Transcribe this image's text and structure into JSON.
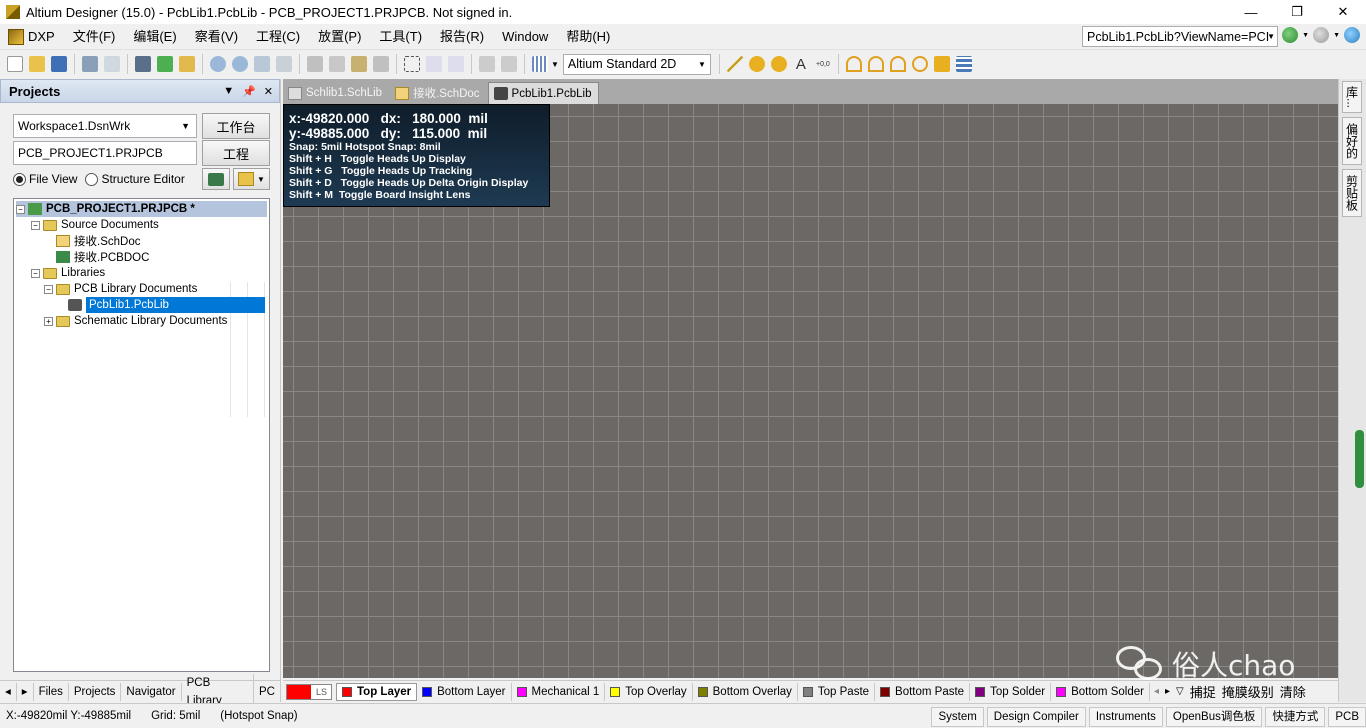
{
  "window": {
    "title": "Altium Designer (15.0) - PcbLib1.PcbLib - PCB_PROJECT1.PRJPCB. Not signed in.",
    "controls": [
      "—",
      "❐",
      "✕"
    ]
  },
  "menu": {
    "items": [
      "DXP",
      "文件(F)",
      "编辑(E)",
      "察看(V)",
      "工程(C)",
      "放置(P)",
      "工具(T)",
      "报告(R)",
      "Window",
      "帮助(H)"
    ],
    "address": "PcbLib1.PcbLib?ViewName=PCI"
  },
  "toolbar": {
    "view_mode": "Altium Standard 2D"
  },
  "projects_panel": {
    "title": "Projects",
    "workspace": "Workspace1.DsnWrk",
    "workspace_button": "工作台",
    "project": "PCB_PROJECT1.PRJPCB",
    "project_button": "工程",
    "view_options": [
      "File View",
      "Structure Editor"
    ],
    "tree": {
      "root": "PCB_PROJECT1.PRJPCB *",
      "source_documents": "Source Documents",
      "sch_doc": "接收.SchDoc",
      "pcb_doc": "接收.PCBDOC",
      "libraries": "Libraries",
      "pcb_library_documents": "PCB Library Documents",
      "pcb_lib": "PcbLib1.PcbLib",
      "schematic_library_documents": "Schematic Library Documents"
    },
    "bottom_tabs": [
      "Files",
      "Projects",
      "Navigator",
      "PCB Library",
      "PC"
    ]
  },
  "document_tabs": [
    "Schlib1.SchLib",
    "接收.SchDoc",
    "PcbLib1.PcbLib"
  ],
  "hud": {
    "line1": "x:-49820.000   dx:   180.000  mil",
    "line2": "y:-49885.000   dy:   115.000  mil",
    "snap": "Snap: 5mil Hotspot Snap: 8mil",
    "shortcuts": [
      "Shift + H   Toggle Heads Up Display",
      "Shift + G   Toggle Heads Up Tracking",
      "Shift + D   Toggle Heads Up Delta Origin Display",
      "Shift + M  Toggle Board Insight Lens"
    ]
  },
  "layers": {
    "ls_label": "LS",
    "items": [
      {
        "name": "Top Layer",
        "color": "#ff0000"
      },
      {
        "name": "Bottom Layer",
        "color": "#0000ff"
      },
      {
        "name": "Mechanical 1",
        "color": "#ff00ff"
      },
      {
        "name": "Top Overlay",
        "color": "#ffff00"
      },
      {
        "name": "Bottom Overlay",
        "color": "#808000"
      },
      {
        "name": "Top Paste",
        "color": "#808080"
      },
      {
        "name": "Bottom Paste",
        "color": "#800000"
      },
      {
        "name": "Top Solder",
        "color": "#800080"
      },
      {
        "name": "Bottom Solder",
        "color": "#ff00ff"
      }
    ],
    "tail_buttons": [
      "捕捉",
      "掩膜级别",
      "清除"
    ]
  },
  "right_tabs": [
    "库...",
    "偏好的",
    "剪贴板"
  ],
  "status": {
    "coords": "X:-49820mil Y:-49885mil",
    "grid": "Grid: 5mil",
    "snap": "(Hotspot Snap)",
    "right_buttons": [
      "System",
      "Design Compiler",
      "Instruments",
      "OpenBus调色板",
      "快捷方式",
      "PCB"
    ]
  },
  "watermark": "俗人chao",
  "colors": {
    "canvas": "#6b6865",
    "grid": "#8a8785",
    "selection": "#0078d7"
  }
}
